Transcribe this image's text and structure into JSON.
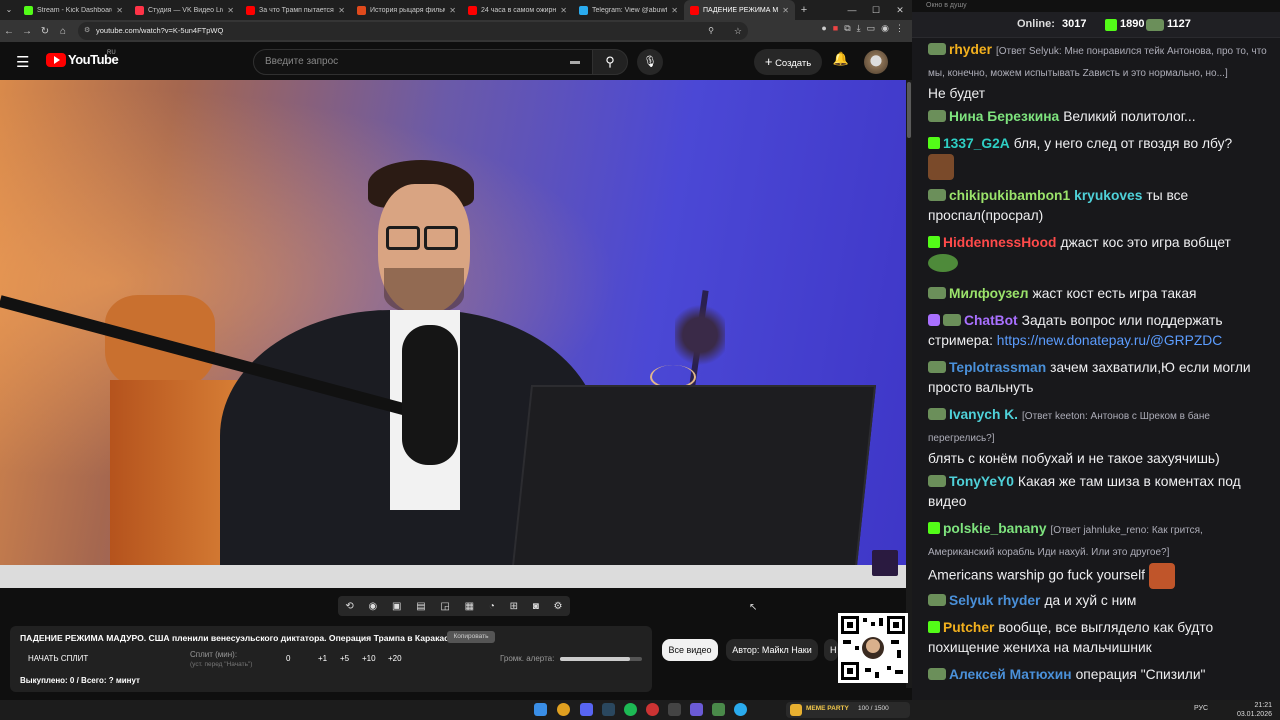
{
  "tabs": [
    {
      "title": "Stream - Kick Dashboard",
      "color": "#53fc18"
    },
    {
      "title": "Студия — VK Видео Live",
      "color": "#ff3347"
    },
    {
      "title": "За что Трамп пытается убить...",
      "color": "#ff0000"
    },
    {
      "title": "История рыцаря фильм, 20...",
      "color": "#e04a1c"
    },
    {
      "title": "24 часа в самом ожирневши...",
      "color": "#ff0000"
    },
    {
      "title": "Telegram: View @abuwtf",
      "color": "#2aabee"
    },
    {
      "title": "ПАДЕНИЕ РЕЖИМА МАДУР...",
      "color": "#ff0000"
    }
  ],
  "window_controls": [
    "—",
    "☐",
    "✕"
  ],
  "address": {
    "url": "youtube.com/watch?v=K-5un4FTpWQ"
  },
  "youtube": {
    "logo_text": "YouTube",
    "logo_region": "RU",
    "search_placeholder": "Введите запрос",
    "create_label": "Создать"
  },
  "video": {
    "title": "ПАДЕНИЕ РЕЖИМА МАДУРО. США пленили венесуэльского диктатора. Операция Трампа в Каракасе",
    "copy_label": "Копировать"
  },
  "split": {
    "start_label": "НАЧАТЬ СПЛИТ",
    "split_label": "Сплит (мин):",
    "split_hint": "(уст. перед \"Начать\")",
    "split_value": "0",
    "increments": [
      "+1",
      "+5",
      "+10",
      "+20"
    ],
    "alert_label": "Громк. алерта:",
    "alert_volume": 0.85,
    "bought_label": "Выкуплено: 0 / Всего: ? минут"
  },
  "filters": {
    "all_videos": "Все видео",
    "author": "Автор: Майкл Наки",
    "more": "Н"
  },
  "chat": {
    "window_title": "Окно в душу",
    "online_label": "Online:",
    "online_count": "3017",
    "followers": "1890",
    "subs": "1127",
    "messages": [
      {
        "user": "rhyder",
        "color": "#f2b01e",
        "badge": "sub",
        "reply": "[Ответ Selyuk: Мне понравился тейк Антонова, про то, что мы, конечно, можем испытывать Zависть и это нормально, но...]",
        "text": "Не будет"
      },
      {
        "user": "Нина Березкина",
        "color": "#7ee37e",
        "badge": "sub",
        "text": "Великий политолог..."
      },
      {
        "user": "1337_G2A",
        "color": "#2ecfc4",
        "badge": "mod",
        "text": "бля, у него след от гвоздя во лбу?"
      },
      {
        "user": "chikipukibambon1",
        "color": "#9be36b",
        "badge": "sub",
        "mention": "kryukoves",
        "text": "ты все проспал(просрал)"
      },
      {
        "user": "HiddennessHood",
        "color": "#ff4a4a",
        "badge": "mod",
        "text": "джаст кос это игра вобщет"
      },
      {
        "user": "Милфоузел",
        "color": "#9be36b",
        "badge": "sub",
        "text": "жаст кост есть игра такая"
      },
      {
        "user": "ChatBot",
        "color": "#a970ff",
        "badge": "bot",
        "text": "Задать вопрос или поддержать стримера:",
        "link": "https://new.donatepay.ru/@GRPZDC"
      },
      {
        "user": "Teplotrassman",
        "color": "#4a90d9",
        "badge": "sub",
        "text": "зачем захватили,Ю если могли просто вальнуть"
      },
      {
        "user": "Ivanych K.",
        "color": "#4fd1d9",
        "badge": "sub",
        "reply": "[Ответ keeton: Антонов с Шреком в бане перегрелись?]",
        "text": "блять с конём побухай и не такое захуячишь)"
      },
      {
        "user": "TonyYeY0",
        "color": "#4fd1d9",
        "badge": "sub",
        "text": "Какая же там шиза в коментах под видео"
      },
      {
        "user": "polskie_banany",
        "color": "#7ee37e",
        "badge": "mod",
        "reply": "[Ответ jahnluke_reno: Как грится, Американский корабль Иди нахуй. Или это другое?]",
        "text": "Americans warship go fuck yourself"
      },
      {
        "user": "Selyuk",
        "color": "#4a90d9",
        "badge": "sub",
        "mention": "rhyder",
        "text": "да и хуй с ним"
      },
      {
        "user": "Putcher",
        "color": "#f2b01e",
        "badge": "mod",
        "text": "вообще, все выглядело как будто похищение жениха на мальчишник"
      },
      {
        "user": "Алексей Матюхин",
        "color": "#4a90d9",
        "badge": "sub",
        "text": "операция \"Спизили\""
      }
    ]
  },
  "taskbar": {
    "lang": "РУС",
    "time": "21:21",
    "date": "03.01.2026",
    "meme_party": "MEME PARTY",
    "meme_counter": "100 / 1500"
  }
}
